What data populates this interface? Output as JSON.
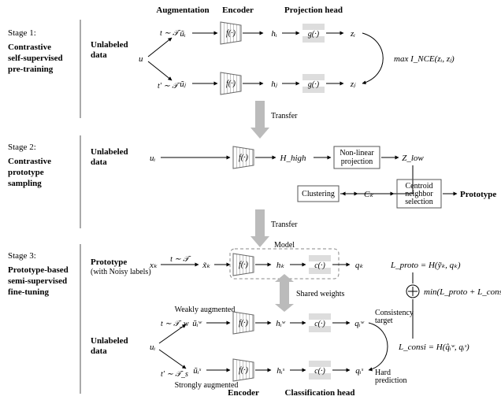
{
  "headers": {
    "aug": "Augmentation",
    "enc": "Encoder",
    "proj": "Projection head",
    "cls": "Classification head",
    "model": "Model"
  },
  "stages": {
    "s1": {
      "title": "Stage 1:",
      "desc1": "Contrastive",
      "desc2": "self-supervised",
      "desc3": "pre-training"
    },
    "s2": {
      "title": "Stage 2:",
      "desc1": "Contrastive",
      "desc2": "prototype",
      "desc3": "sampling"
    },
    "s3": {
      "title": "Stage 3:",
      "desc1": "Prototype-based",
      "desc2": "semi-supervised",
      "desc3": "fine-tuning"
    }
  },
  "labels": {
    "unlabeled": "Unlabeled",
    "data": "data",
    "prototype": "Prototype",
    "noisy": "(with Noisy labels)",
    "transfer": "Transfer",
    "shared": "Shared weights",
    "weakAug": "Weakly augmented",
    "strongAug": "Strongly augmented",
    "consTarget": "Consistency",
    "consTarget2": "target",
    "hardPred": "Hard",
    "hardPred2": "prediction",
    "nonlin1": "Non-linear",
    "nonlin2": "projection",
    "clustering": "Clustering",
    "centroid1": "Centroid",
    "centroid2": "neighbor",
    "centroid3": "selection",
    "protoOut": "Prototype"
  },
  "math": {
    "u": "u",
    "ui": "uᵢ",
    "xk": "xₖ",
    "uj": "uⱼ",
    "t_T": "t ∼ 𝒯",
    "tp_T": "t′ ∼ 𝒯",
    "t_Tw": "t ∼ 𝒯_w",
    "tp_Ts": "t′ ∼ 𝒯_s",
    "ut_i": "ũᵢ",
    "ut_j": "ũⱼ",
    "xt_k": "x̃ₖ",
    "ut_iw": "ũᵢʷ",
    "ut_is": "ũᵢˢ",
    "f": "f(·)",
    "g": "g(·)",
    "c": "c(·)",
    "hi": "hᵢ",
    "hj": "hⱼ",
    "hk": "hₖ",
    "hiw": "hᵢʷ",
    "his": "hᵢˢ",
    "zi": "zᵢ",
    "zj": "zⱼ",
    "qk": "qₖ",
    "qiw": "qᵢʷ",
    "qis": "qᵢˢ",
    "Hhigh": "H_high",
    "Zlow": "Z_low",
    "Ck": "Cₖ",
    "maxI": "max I_NCE(zᵢ, zⱼ)",
    "Lproto": "L_proto = H(ỹₖ, qₖ)",
    "Lconsi": "L_consi = H(q̂ᵢʷ, qᵢˢ)",
    "minL": "min(L_proto + L_consi)",
    "plus": "⊕"
  }
}
